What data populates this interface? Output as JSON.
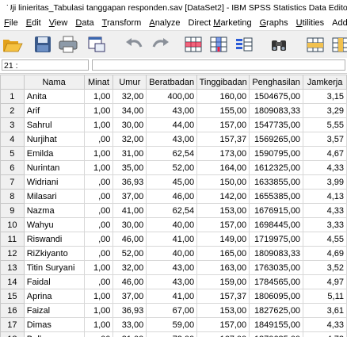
{
  "window": {
    "title": "Uji linieritas_Tabulasi tanggapan responden.sav [DataSet2] - IBM SPSS Statistics Data Editor"
  },
  "menu": [
    {
      "pre": "",
      "ul": "F",
      "post": "ile"
    },
    {
      "pre": "",
      "ul": "E",
      "post": "dit"
    },
    {
      "pre": "",
      "ul": "V",
      "post": "iew"
    },
    {
      "pre": "",
      "ul": "D",
      "post": "ata"
    },
    {
      "pre": "",
      "ul": "T",
      "post": "ransform"
    },
    {
      "pre": "",
      "ul": "A",
      "post": "nalyze"
    },
    {
      "pre": "Direct ",
      "ul": "M",
      "post": "arketing"
    },
    {
      "pre": "",
      "ul": "G",
      "post": "raphs"
    },
    {
      "pre": "",
      "ul": "U",
      "post": "tilities"
    },
    {
      "pre": "Add-",
      "ul": "",
      "post": ""
    }
  ],
  "toolbar": [
    "open-icon",
    "save-icon",
    "print-icon",
    "dialog-recall-icon",
    "undo-icon",
    "redo-icon",
    "goto-case-icon",
    "goto-variable-icon",
    "variables-icon",
    "find-icon",
    "insert-cases-icon",
    "insert-variable-icon",
    "split-file-icon"
  ],
  "cellbar": {
    "ref": "21 :",
    "value": ""
  },
  "columns": [
    "Nama",
    "Minat",
    "Umur",
    "Beratbadan",
    "Tinggibadan",
    "Penghasilan",
    "Jamkerja"
  ],
  "rows": [
    {
      "n": "1",
      "v": [
        "Anita",
        "1,00",
        "32,00",
        "400,00",
        "160,00",
        "1504675,00",
        "3,15"
      ]
    },
    {
      "n": "2",
      "v": [
        "Arif",
        "1,00",
        "34,00",
        "43,00",
        "155,00",
        "1809083,33",
        "3,29"
      ]
    },
    {
      "n": "3",
      "v": [
        "Sahrul",
        "1,00",
        "30,00",
        "44,00",
        "157,00",
        "1547735,00",
        "5,55"
      ]
    },
    {
      "n": "4",
      "v": [
        "Nurjihat",
        ",00",
        "32,00",
        "43,00",
        "157,37",
        "1569265,00",
        "3,57"
      ]
    },
    {
      "n": "5",
      "v": [
        "Emilda",
        "1,00",
        "31,00",
        "62,54",
        "173,00",
        "1590795,00",
        "4,67"
      ]
    },
    {
      "n": "6",
      "v": [
        "Nurintan",
        "1,00",
        "35,00",
        "52,00",
        "164,00",
        "1612325,00",
        "4,33"
      ]
    },
    {
      "n": "7",
      "v": [
        "Widriani",
        ",00",
        "36,93",
        "45,00",
        "150,00",
        "1633855,00",
        "3,99"
      ]
    },
    {
      "n": "8",
      "v": [
        "Milasari",
        ",00",
        "37,00",
        "46,00",
        "142,00",
        "1655385,00",
        "4,13"
      ]
    },
    {
      "n": "9",
      "v": [
        "Nazma",
        ",00",
        "41,00",
        "62,54",
        "153,00",
        "1676915,00",
        "4,33"
      ]
    },
    {
      "n": "10",
      "v": [
        "Wahyu",
        ",00",
        "30,00",
        "40,00",
        "157,00",
        "1698445,00",
        "3,33"
      ]
    },
    {
      "n": "11",
      "v": [
        "Riswandi",
        ",00",
        "46,00",
        "41,00",
        "149,00",
        "1719975,00",
        "4,55"
      ]
    },
    {
      "n": "12",
      "v": [
        "RiZkiyanto",
        ",00",
        "52,00",
        "40,00",
        "165,00",
        "1809083,33",
        "4,69"
      ]
    },
    {
      "n": "13",
      "v": [
        "Titin Suryani",
        "1,00",
        "32,00",
        "43,00",
        "163,00",
        "1763035,00",
        "3,52"
      ]
    },
    {
      "n": "14",
      "v": [
        "Faidal",
        ",00",
        "46,00",
        "43,00",
        "159,00",
        "1784565,00",
        "4,97"
      ]
    },
    {
      "n": "15",
      "v": [
        "Aprina",
        "1,00",
        "37,00",
        "41,00",
        "157,37",
        "1806095,00",
        "5,11"
      ]
    },
    {
      "n": "16",
      "v": [
        "Faizal",
        "1,00",
        "36,93",
        "67,00",
        "153,00",
        "1827625,00",
        "3,61"
      ]
    },
    {
      "n": "17",
      "v": [
        "Dimas",
        "1,00",
        "33,00",
        "59,00",
        "157,00",
        "1849155,00",
        "4,33"
      ]
    },
    {
      "n": "18",
      "v": [
        "Bella",
        ",00",
        "31,00",
        "72,00",
        "167,00",
        "1870685,00",
        "4,72"
      ]
    }
  ]
}
